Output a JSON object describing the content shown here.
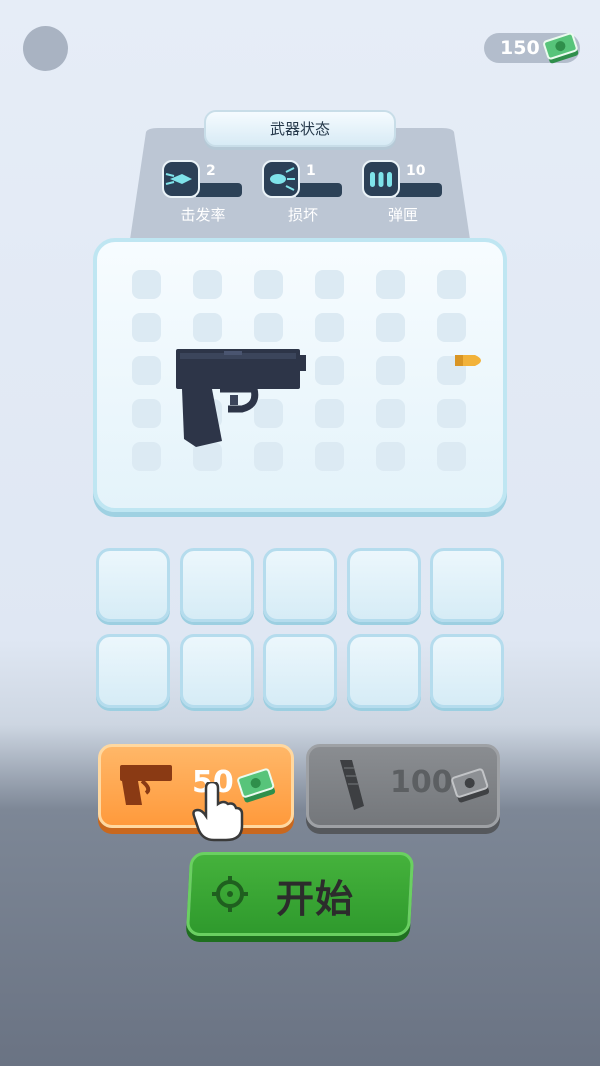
{
  "header": {
    "cash": "150"
  },
  "stats": {
    "title": "武器状态",
    "items": [
      {
        "icon": "fire-rate-icon",
        "value": "2",
        "label": "击发率"
      },
      {
        "icon": "damage-icon",
        "value": "1",
        "label": "损坏"
      },
      {
        "icon": "magazine-icon",
        "value": "10",
        "label": "弹匣"
      }
    ]
  },
  "board": {
    "rows": 5,
    "cols": 6,
    "weapon": "pistol",
    "projectile": "bullet"
  },
  "inventory": {
    "rows": 2,
    "cols": 5
  },
  "shop": {
    "buy_weapon_price": "50",
    "buy_ammo_price": "100"
  },
  "start": {
    "label": "开始"
  },
  "colors": {
    "buy_button": "#ff9a3c",
    "ammo_button_disabled": "#74777b",
    "start_button": "#2f9a2d",
    "board_border": "#bfe6f2",
    "cash_green": "#57c47a"
  }
}
